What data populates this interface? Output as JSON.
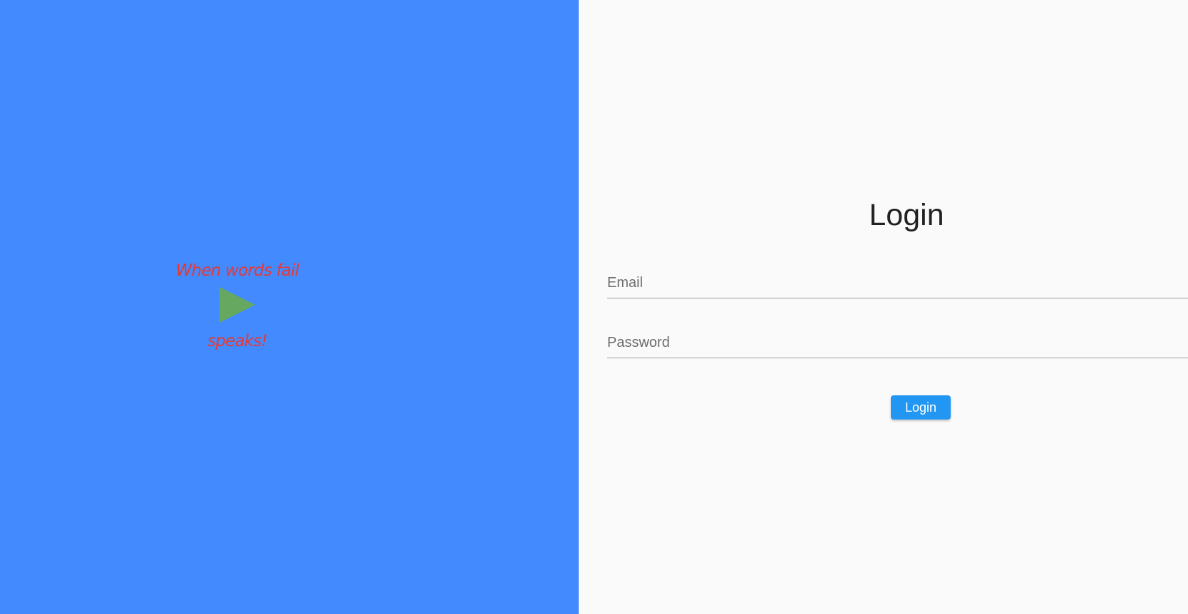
{
  "left_panel": {
    "background_color": "#448AFF",
    "tagline_top": "When words fail",
    "tagline_bottom": "speaks!",
    "tagline_color": "#E53935",
    "icon": "play-icon",
    "icon_color": "#66A85F"
  },
  "login": {
    "title": "Login",
    "email_placeholder": "Email",
    "email_value": "",
    "password_placeholder": "Password",
    "password_value": "",
    "button_label": "Login",
    "button_color": "#2196F3"
  }
}
